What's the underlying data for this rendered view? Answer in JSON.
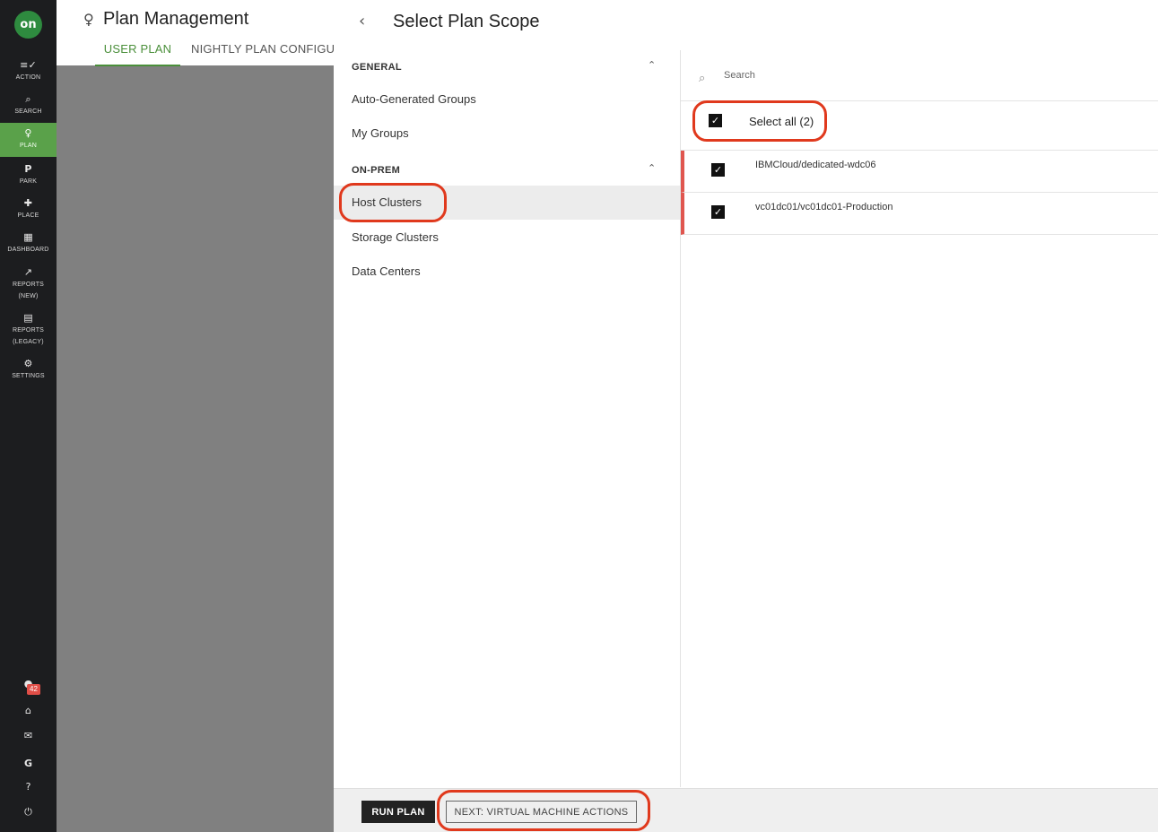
{
  "nav": {
    "logo": "on",
    "items": [
      {
        "label": "ACTION",
        "icon": "action-icon",
        "glyph": "≡✓"
      },
      {
        "label": "SEARCH",
        "icon": "search-icon",
        "glyph": "⌕"
      },
      {
        "label": "PLAN",
        "icon": "bulb-icon",
        "glyph": "💡"
      },
      {
        "label": "PARK",
        "icon": "park-icon",
        "glyph": "P"
      },
      {
        "label": "PLACE",
        "icon": "puzzle-icon",
        "glyph": "✚"
      },
      {
        "label": "DASHBOARD",
        "icon": "dashboard-icon",
        "glyph": "▦"
      },
      {
        "label": "REPORTS",
        "label2": "(NEW)",
        "icon": "chart-icon",
        "glyph": "↗"
      },
      {
        "label": "REPORTS",
        "label2": "(LEGACY)",
        "icon": "clipboard-icon",
        "glyph": "▤"
      },
      {
        "label": "SETTINGS",
        "icon": "gear-icon",
        "glyph": "⚙"
      }
    ],
    "notification_count": "42"
  },
  "background_page": {
    "title": "Plan Management",
    "tabs": [
      "USER PLAN",
      "NIGHTLY PLAN CONFIGURATION"
    ]
  },
  "drawer": {
    "title": "Select Plan Scope",
    "sections": [
      {
        "label": "GENERAL",
        "items": [
          "Auto-Generated Groups",
          "My Groups"
        ]
      },
      {
        "label": "ON-PREM",
        "items": [
          "Host Clusters",
          "Storage Clusters",
          "Data Centers"
        ]
      }
    ],
    "search_placeholder": "Search",
    "select_all_label": "Select all (2)",
    "rows": [
      "IBMCloud/dedicated-wdc06",
      "vc01dc01/vc01dc01-Production"
    ],
    "footer": {
      "run": "RUN PLAN",
      "next": "NEXT: VIRTUAL MACHINE ACTIONS"
    }
  },
  "colors": {
    "accent_green": "#5aa14a",
    "highlight_ring": "#e0391d",
    "row_marker": "#e0564f"
  }
}
